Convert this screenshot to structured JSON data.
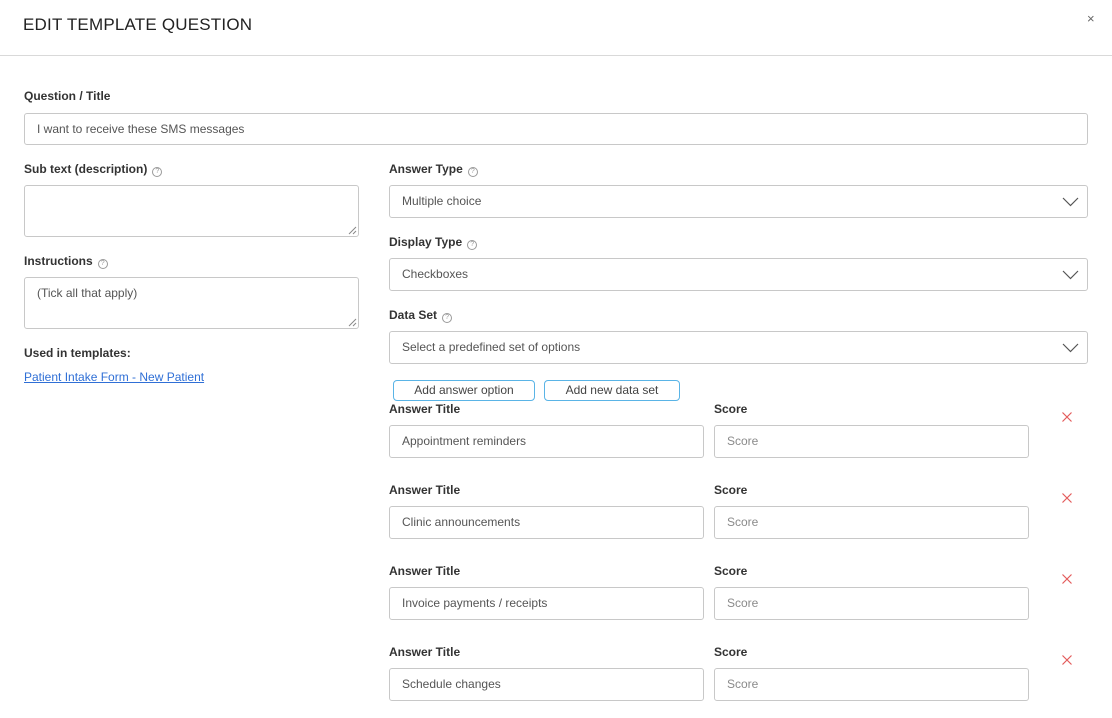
{
  "modal": {
    "title": "EDIT TEMPLATE QUESTION",
    "close": "×"
  },
  "question": {
    "label": "Question / Title",
    "value": "I want to receive these SMS messages"
  },
  "subtext": {
    "label": "Sub text (description)",
    "value": ""
  },
  "instructions": {
    "label": "Instructions",
    "value": "(Tick all that apply)"
  },
  "used_in": {
    "label": "Used in templates:",
    "links": [
      "Patient Intake Form - New Patient"
    ]
  },
  "answer_type": {
    "label": "Answer Type",
    "value": "Multiple choice"
  },
  "display_type": {
    "label": "Display Type",
    "value": "Checkboxes"
  },
  "data_set": {
    "label": "Data Set",
    "placeholder": "Select a predefined set of options"
  },
  "buttons": {
    "add_answer": "Add answer option",
    "add_data_set": "Add new data set"
  },
  "answers": [
    {
      "title_label": "Answer Title",
      "title": "Appointment reminders",
      "score_label": "Score",
      "score_placeholder": "Score"
    },
    {
      "title_label": "Answer Title",
      "title": "Clinic announcements",
      "score_label": "Score",
      "score_placeholder": "Score"
    },
    {
      "title_label": "Answer Title",
      "title": "Invoice payments / receipts",
      "score_label": "Score",
      "score_placeholder": "Score"
    },
    {
      "title_label": "Answer Title",
      "title": "Schedule changes",
      "score_label": "Score",
      "score_placeholder": "Score"
    }
  ],
  "colors": {
    "remove": "#e45b5b",
    "button_border": "#5ab4e6",
    "link": "#2f6fd6"
  }
}
